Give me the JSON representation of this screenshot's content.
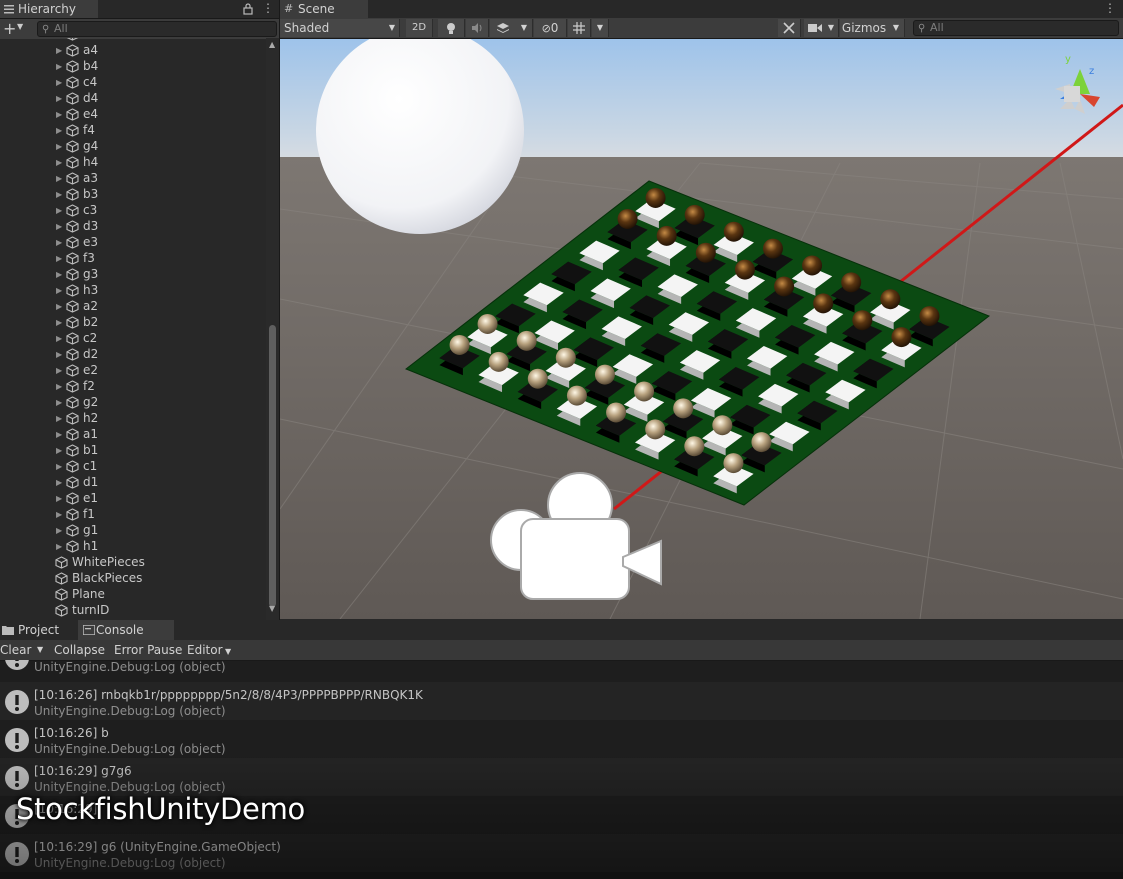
{
  "hierarchy": {
    "tab_label": "Hierarchy",
    "search_placeholder": "All",
    "squares": [
      "a4",
      "b4",
      "c4",
      "d4",
      "e4",
      "f4",
      "g4",
      "h4",
      "a3",
      "b3",
      "c3",
      "d3",
      "e3",
      "f3",
      "g3",
      "h3",
      "a2",
      "b2",
      "c2",
      "d2",
      "e2",
      "f2",
      "g2",
      "h2",
      "a1",
      "b1",
      "c1",
      "d1",
      "e1",
      "f1",
      "g1",
      "h1"
    ],
    "objects": [
      "WhitePieces",
      "BlackPieces",
      "Plane",
      "turnID"
    ]
  },
  "scene": {
    "tab_label": "Scene",
    "shading_mode": "Shaded",
    "mode_2d": "2D",
    "hidden_count": "0",
    "gizmos_label": "Gizmos",
    "search_placeholder": "All",
    "axis_y": "y",
    "axis_z": "z"
  },
  "bottom_tabs": {
    "project": "Project",
    "console": "Console"
  },
  "console": {
    "clear": "Clear",
    "collapse": "Collapse",
    "error_pause": "Error Pause",
    "editor": "Editor",
    "partial_top_line": "UnityEngine.Debug:Log (object)",
    "entries": [
      {
        "message": "[10:16:26] rnbqkb1r/pppppppp/5n2/8/8/4P3/PPPPBPPP/RNBQK1K",
        "source": "UnityEngine.Debug:Log (object)"
      },
      {
        "message": "[10:16:26] b",
        "source": "UnityEngine.Debug:Log (object)"
      },
      {
        "message": "[10:16:29] g7g6",
        "source": "UnityEngine.Debug:Log (object)"
      },
      {
        "message": "[10:16:29]",
        "source": ""
      },
      {
        "message": "[10:16:29] g6 (UnityEngine.GameObject)",
        "source": "UnityEngine.Debug:Log (object)"
      }
    ]
  },
  "video_title": "StockfishUnityDemo",
  "colors": {
    "board_green": "#0b4a12",
    "white_square": "#f2f2f2",
    "black_square": "#0a0a0a",
    "sky_top": "#a9c8e8",
    "ground": "#6a6460",
    "ray": "#d01818"
  }
}
